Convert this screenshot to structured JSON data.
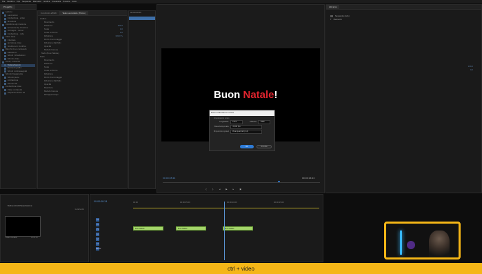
{
  "menubar": {
    "items": [
      "File",
      "Modifica",
      "Clip",
      "Sequenza",
      "Marcatori",
      "Grafica",
      "Visualizza",
      "Finestra",
      "Aiuto"
    ]
  },
  "project_panel": {
    "tree": [
      {
        "label": "Lezione",
        "selected": false
      },
      {
        "label": "Lavorazioni",
        "selected": false
      },
      {
        "label": "Contenitore - video",
        "selected": false
      },
      {
        "label": "Miniature",
        "selected": false
      },
      {
        "label": "Copiatore sky divisione",
        "selected": false
      },
      {
        "label": "Scrivania sky divisione",
        "selected": false
      },
      {
        "label": "Immagini - rumori",
        "selected": false
      },
      {
        "label": "Contenitore - note",
        "selected": false
      },
      {
        "label": "Video base",
        "selected": false
      },
      {
        "label": "Clientele",
        "selected": false
      },
      {
        "label": "Iscrizione video",
        "selected": false
      },
      {
        "label": "Struttura di modifica",
        "selected": false
      },
      {
        "label": "Blocchi di un contenuto",
        "selected": false
      },
      {
        "label": "Riflessioni",
        "selected": false
      },
      {
        "label": "Sfondi / Intestazioni",
        "selected": false
      },
      {
        "label": "Sfondo video",
        "selected": false
      },
      {
        "label": "Titoli / contenuti",
        "selected": false
      },
      {
        "label": "Tutorial tecnici",
        "selected": true
      },
      {
        "label": "Elementi grafici",
        "selected": false
      },
      {
        "label": "Sfondi contrassegnati",
        "selected": false
      },
      {
        "label": "Sfondo trasparente",
        "selected": false
      },
      {
        "label": "Sfondo pieno",
        "selected": false
      },
      {
        "label": "Animazione",
        "selected": false
      },
      {
        "label": "Sfondo HD",
        "selected": false
      },
      {
        "label": "Contenitore video",
        "selected": false
      },
      {
        "label": "Video contenuto",
        "selected": false
      },
      {
        "label": "Sequenza demo 02",
        "selected": false
      }
    ]
  },
  "effect_controls": {
    "tabs": [
      "Controllo effetti",
      "Testo annotato (Titolo)"
    ],
    "props": [
      "Grafica",
      "Movimento",
      "Posizione",
      "Scala",
      "Scala uniforme",
      "Rotazione",
      "Punto di ancoraggio",
      "Riduzione sfarfallio",
      "Opacità",
      "Metodo fusione",
      "Testo (Buon Natale)",
      "Testo",
      "Movimento",
      "Posizione",
      "Scala",
      "Scala uniforme",
      "Rotazione",
      "Punto di ancoraggio",
      "Riduzione sfarfallio",
      "Opacità",
      "Maschera",
      "Metodo fusione",
      "Rimappa tempo"
    ],
    "values": [
      "100,0",
      "0,0",
      "0,0",
      "100,0 %",
      "960,0",
      "540,0"
    ]
  },
  "source_list": {
    "tab": "00:00:00:00"
  },
  "program_monitor": {
    "title_white": "Buon ",
    "title_red": "Natale",
    "title_excl": "!",
    "timecode_left": "00:00:08:24",
    "timecode_right": "00:00:14:24",
    "fit": "Adatta"
  },
  "dialog": {
    "title": "Nuovo mascherino colore",
    "section": "Impostazioni video",
    "width_label": "Larghezza:",
    "width_value": "1920",
    "height_label": "Altezza:",
    "height_value": "1080",
    "timebase_label": "Base temporale:",
    "timebase_value": "25,00 fps",
    "pixel_aspect_label": "Proporzioni pixel:",
    "pixel_aspect_value": "Pixel quadrati (1,0)",
    "ok_label": "OK",
    "cancel_label": "Annulla"
  },
  "right_panel": {
    "tab": "Libreria",
    "items": [
      "Sequenza demo",
      "Elemento"
    ],
    "bottom_values": [
      "100,0",
      "0,0"
    ]
  },
  "bottom_left": {
    "bin_label": "Testi animati Presentazione",
    "count": "1 elemento",
    "thumb_label": "Titolo modello",
    "thumb_duration": "00:05:00"
  },
  "timeline": {
    "timecode": "00:00:08:24",
    "ruler": [
      "00:00",
      "00:00:05:00",
      "00:00:10:00",
      "00:00:15:00"
    ],
    "tracks": [
      "V3",
      "V2",
      "V1",
      "A1",
      "A2",
      "A3",
      "Master"
    ],
    "clips": [
      "Buon Natale",
      "Buon Natale",
      "Buon Natale"
    ]
  },
  "subtitle": "ctrl + video",
  "colors": {
    "accent": "#2e7bd6",
    "clip": "#a4d66a",
    "highlight": "#f5b617",
    "title_red": "#e0242e"
  }
}
